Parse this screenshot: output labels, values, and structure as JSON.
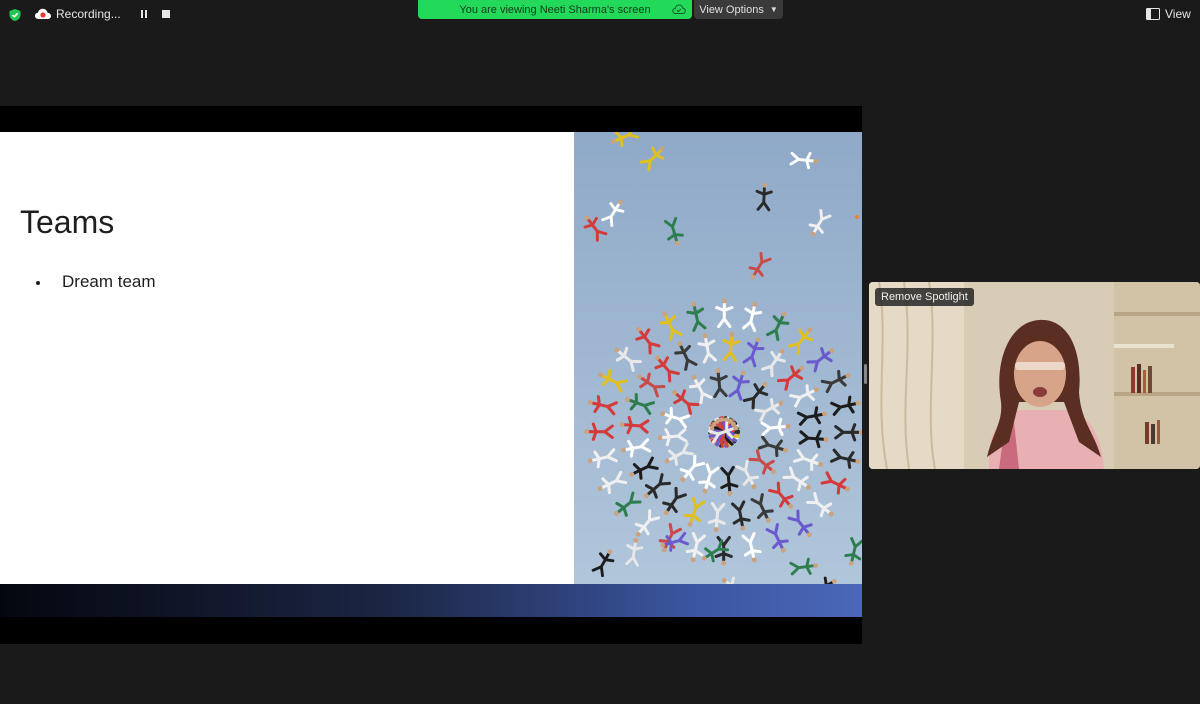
{
  "toolbar": {
    "recording_label": "Recording...",
    "view_options_label": "View Options",
    "view_label": "View"
  },
  "banner": {
    "viewing_text": "You are viewing Neeti Sharma's screen"
  },
  "slide": {
    "title": "Teams",
    "bullets": [
      "Dream team"
    ]
  },
  "video": {
    "remove_spotlight_label": "Remove Spotlight"
  },
  "colors": {
    "banner_green": "#23d959",
    "background": "#1a1a1a",
    "recording_red": "#e53935",
    "sky_blue": "#9fb8d3"
  },
  "icons": [
    "shield-icon",
    "cloud-recording-icon",
    "pause-icon",
    "stop-icon",
    "cloud-icon",
    "chevron-down-icon",
    "view-icon"
  ]
}
